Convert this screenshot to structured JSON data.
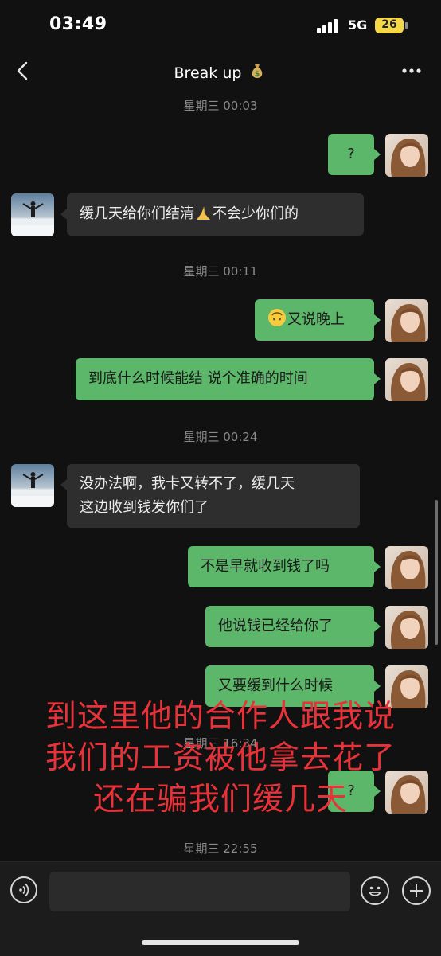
{
  "status_bar": {
    "time": "03:49",
    "network": "5G",
    "battery": "26"
  },
  "header": {
    "title": "Break up",
    "title_icon": "money-bag-icon"
  },
  "timestamps": [
    "星期三 00:03",
    "星期三 00:11",
    "星期三 00:24",
    "星期三 16:34",
    "星期三 22:55"
  ],
  "messages": [
    {
      "from": "me",
      "text": "?"
    },
    {
      "from": "them",
      "text": "缓几天给你们结清",
      "text_after": "不会少你们的",
      "inline_icon": "praying-hands-icon"
    },
    {
      "from": "me",
      "text": "又说晚上",
      "inline_icon": "upside-down-face-icon"
    },
    {
      "from": "me",
      "text": "到底什么时候能结 说个准确的时间"
    },
    {
      "from": "them",
      "lines": [
        "没办法啊，我卡又转不了，缓几天",
        "这边收到钱发你们了"
      ]
    },
    {
      "from": "me",
      "text": "不是早就收到钱了吗"
    },
    {
      "from": "me",
      "text": "他说钱已经给你了"
    },
    {
      "from": "me",
      "text": "又要缓到什么时候"
    },
    {
      "from": "me",
      "text": "?"
    }
  ],
  "overlay": {
    "color": "#e8323a",
    "lines": [
      "到这里他的合作人跟我说",
      "我们的工资被他拿去花了",
      "还在骗我们缓几天"
    ]
  },
  "colors": {
    "bubble_me": "#5cb76a",
    "bubble_them": "#2e2e2e",
    "background": "#111111"
  }
}
